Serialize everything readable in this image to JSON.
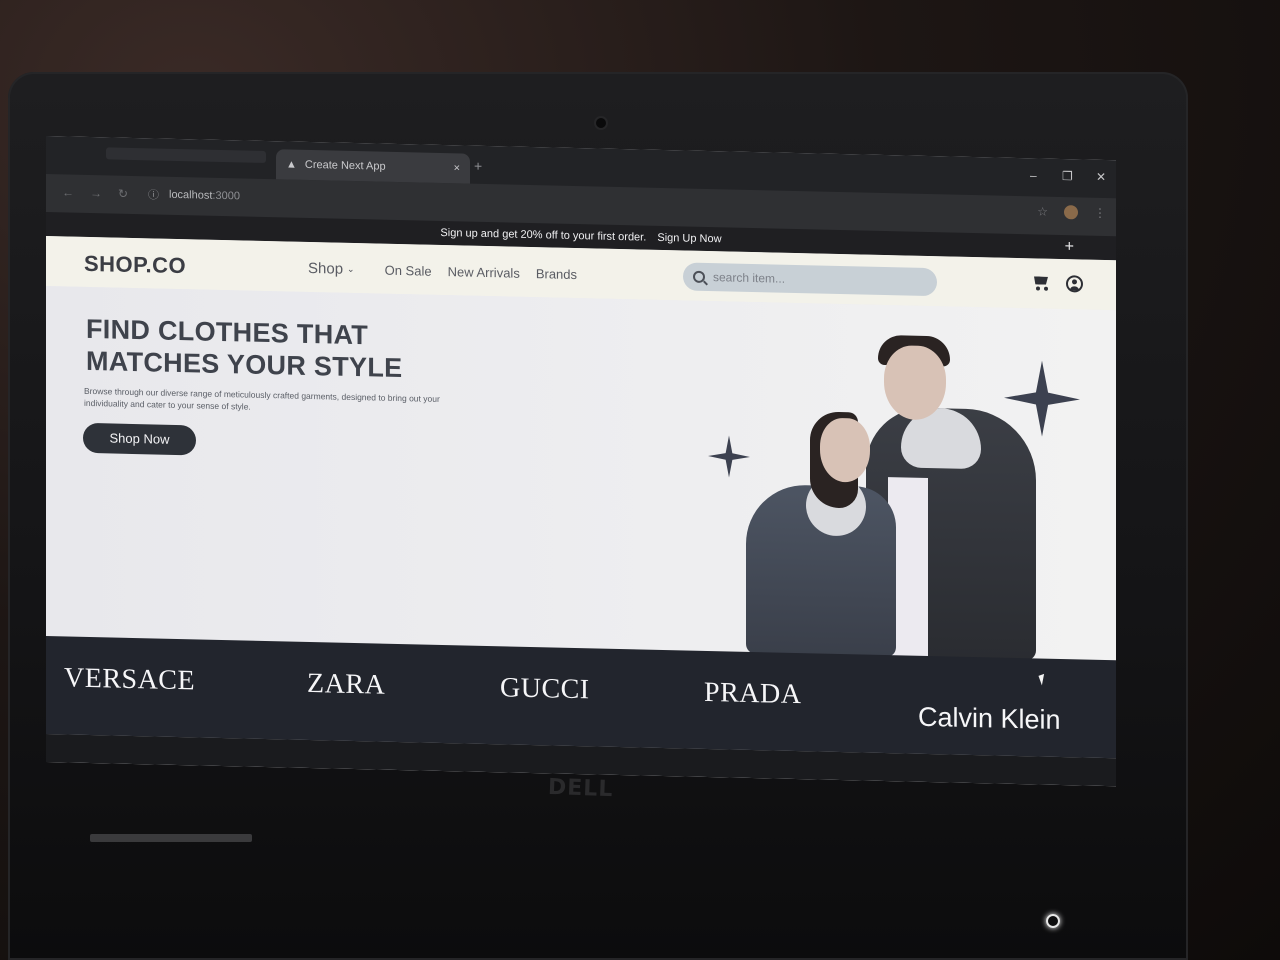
{
  "browser": {
    "tab_title": "Create Next App",
    "tab_close": "×",
    "new_tab": "+",
    "window_controls": {
      "minimize": "–",
      "restore": "❐",
      "close": "✕"
    },
    "nav": {
      "back": "←",
      "forward": "→",
      "reload": "↻"
    },
    "address_host": "localhost",
    "address_port": ":3000",
    "toolbar": {
      "star": "☆",
      "menu": "⋮"
    }
  },
  "promo": {
    "text": "Sign up and get 20% off to your first order.",
    "link": "Sign Up Now",
    "close": "+"
  },
  "nav": {
    "logo": "SHOP.CO",
    "shop": "Shop",
    "shop_chevron": "⌄",
    "links": [
      "On Sale",
      "New Arrivals",
      "Brands"
    ],
    "search_placeholder": "search item..."
  },
  "hero": {
    "title_line1": "FIND CLOTHES THAT",
    "title_line2": "MATCHES YOUR STYLE",
    "subtitle": "Browse through our diverse range of meticulously crafted garments, designed to bring out your individuality and cater to your sense of style.",
    "cta": "Shop Now"
  },
  "brands": [
    "VERSACE",
    "ZARA",
    "GUCCI",
    "PRADA",
    "Calvin Klein"
  ],
  "laptop": {
    "logo": "DELL"
  },
  "colors": {
    "dark": "#22252d",
    "nav_bg": "#f3f2ea",
    "hero_bg": "#ebebee",
    "search_bg": "#c8d0d6"
  },
  "icons": [
    "search-icon",
    "cart-icon",
    "user-icon",
    "sparkle-icon"
  ]
}
